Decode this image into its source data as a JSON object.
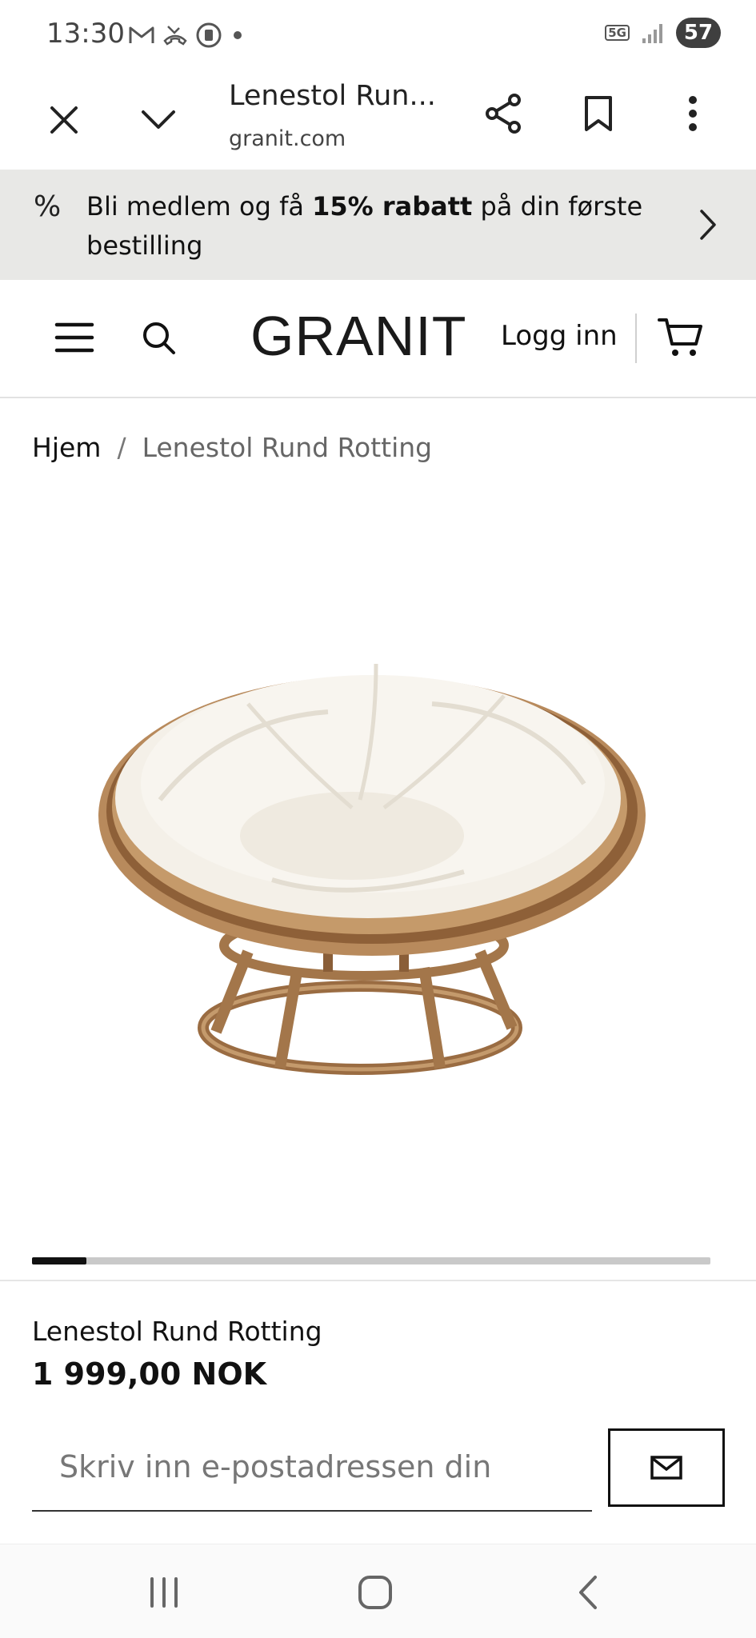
{
  "status_bar": {
    "time": "13:30",
    "network": "5G",
    "battery": "57",
    "icons": [
      "gmail-icon",
      "missed-call-icon",
      "notification-icon",
      "dot-icon",
      "signal-icon"
    ]
  },
  "browser": {
    "title": "Lenestol Run...",
    "url": "granit.com"
  },
  "promo": {
    "text_before": "Bli medlem og få ",
    "text_bold": "15% rabatt",
    "text_after": " på din første bestilling"
  },
  "header": {
    "logo": "GRANIT",
    "login": "Logg inn"
  },
  "breadcrumb": {
    "home": "Hjem",
    "separator": "/",
    "current": "Lenestol Rund Rotting"
  },
  "gallery": {
    "progress": 0.08
  },
  "product": {
    "name": "Lenestol Rund Rotting",
    "price": "1 999,00 NOK"
  },
  "newsletter": {
    "placeholder": "Skriv inn e-postadressen din"
  }
}
